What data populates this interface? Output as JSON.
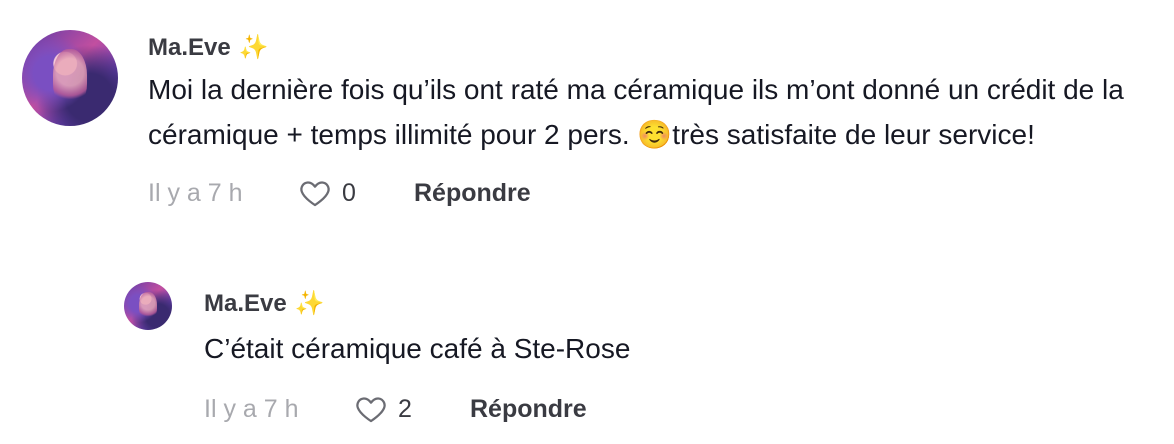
{
  "comments": [
    {
      "username": "Ma.Eve",
      "badge": "✨",
      "text": "Moi la dernière fois qu’ils ont raté ma céramique ils m’ont donné un crédit de la céramique + temps illimité pour 2 pers. ☺️très satisfaite de leur service!",
      "time": "Il y a 7 h",
      "likes": "0",
      "reply_label": "Répondre"
    },
    {
      "username": "Ma.Eve",
      "badge": "✨",
      "text": "C’était céramique café à Ste-Rose",
      "time": "Il y a 7 h",
      "likes": "2",
      "reply_label": "Répondre"
    }
  ],
  "icons": {
    "like": "heart-outline-icon",
    "badge": "sparkles-icon"
  },
  "colors": {
    "username": "#3a3b42",
    "text": "#161823",
    "timestamp": "#a8a9ae",
    "sparkle": "#f3c64a"
  }
}
